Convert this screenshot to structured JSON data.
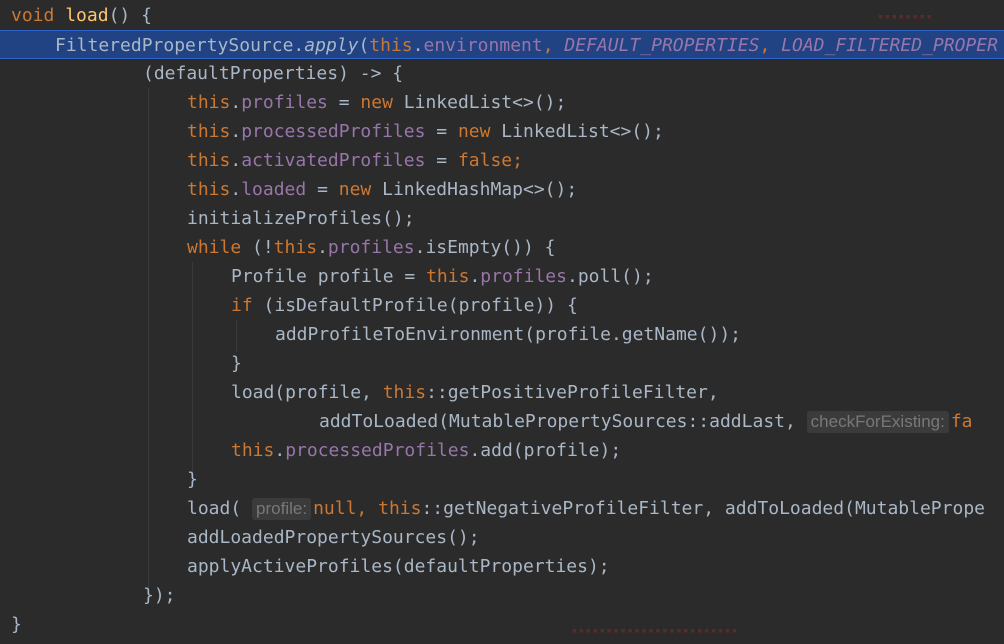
{
  "code": {
    "l1": {
      "void": "void",
      "load": "load",
      "rest": "() {"
    },
    "l2": {
      "cls": "FilteredPropertySource",
      "dot": ".",
      "apply": "apply",
      "paren": "(",
      "this": "this",
      "dot2": ".",
      "env": "environment",
      "comma": ", ",
      "defprops": "DEFAULT_PROPERTIES",
      "comma2": ", ",
      "lfp": "LOAD_FILTERED_PROPER"
    },
    "l3": {
      "text": "(defaultProperties) -> {"
    },
    "l4": {
      "this": "this",
      "dot": ".",
      "field": "profiles",
      "eq": " = ",
      "new": "new",
      "rest": " LinkedList<>();"
    },
    "l5": {
      "this": "this",
      "dot": ".",
      "field": "processedProfiles",
      "eq": " = ",
      "new": "new",
      "rest": " LinkedList<>();"
    },
    "l6": {
      "this": "this",
      "dot": ".",
      "field": "activatedProfiles",
      "eq": " = ",
      "false": "false",
      "semi": ";"
    },
    "l7": {
      "this": "this",
      "dot": ".",
      "field": "loaded",
      "eq": " = ",
      "new": "new",
      "rest": " LinkedHashMap<>();"
    },
    "l8": {
      "text": "initializeProfiles();"
    },
    "l9": {
      "while": "while",
      "open": " (!",
      "this": "this",
      "dot": ".",
      "field": "profiles",
      "rest": ".isEmpty()) {"
    },
    "l10": {
      "pre": "Profile profile = ",
      "this": "this",
      "dot": ".",
      "field": "profiles",
      "rest": ".poll();"
    },
    "l11": {
      "if": "if",
      "rest": " (isDefaultProfile(profile)) {"
    },
    "l12": {
      "text": "addProfileToEnvironment(profile.getName());"
    },
    "l13": {
      "text": "}"
    },
    "l14": {
      "pre": "load(profile, ",
      "this": "this",
      "rest": "::getPositiveProfileFilter,"
    },
    "l15": {
      "pre": "addToLoaded(MutablePropertySources::addLast, ",
      "hint": "checkForExisting:",
      "tail": "fa"
    },
    "l16": {
      "this": "this",
      "dot": ".",
      "field": "processedProfiles",
      "rest": ".add(profile);"
    },
    "l17": {
      "text": "}"
    },
    "l18": {
      "pre": "load( ",
      "hint": "profile:",
      "null": "null",
      "comma": ", ",
      "this": "this",
      "rest": "::getNegativeProfileFilter, addToLoaded(MutablePrope"
    },
    "l19": {
      "text": "addLoadedPropertySources();"
    },
    "l20": {
      "text": "applyActiveProfiles(defaultProperties);"
    },
    "l21": {
      "text": "});"
    },
    "l22": {
      "text": "}"
    }
  },
  "colors": {
    "background": "#2b2b2b",
    "keyword": "#cc7832",
    "method": "#ffc66d",
    "field": "#9876aa",
    "plain": "#a9b7c6",
    "selection": "#214283"
  }
}
